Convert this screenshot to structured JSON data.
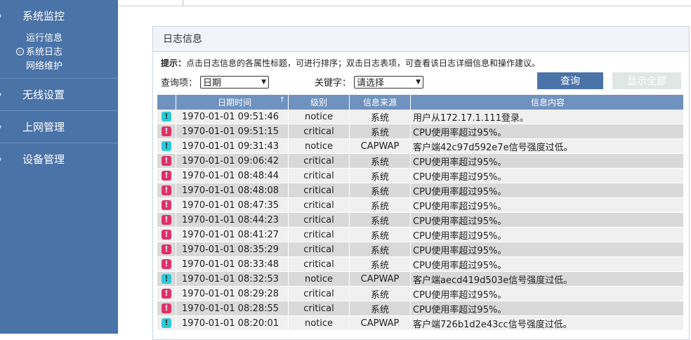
{
  "sidebar": {
    "groups": [
      {
        "label": "系统监控",
        "subitems": [
          "运行信息",
          "系统日志",
          "网络维护"
        ]
      },
      {
        "label": "无线设置"
      },
      {
        "label": "上网管理"
      },
      {
        "label": "设备管理"
      }
    ]
  },
  "panel": {
    "title": "日志信息",
    "tip_label": "提示：",
    "tip_text": "点击日志信息的各属性标题，可进行排序；双击日志表项，可查看该日志详细信息和操作建议。"
  },
  "query": {
    "field_label": "查询项：",
    "field_value": "日期",
    "keyword_label": "关键字：",
    "keyword_value": "请选择",
    "query_button": "查询",
    "show_all_button": "显示全部"
  },
  "table": {
    "headers": {
      "time": "日期时间",
      "level": "级别",
      "source": "信息来源",
      "message": "信息内容"
    },
    "rows": [
      {
        "time": "1970-01-01 09:51:46",
        "level": "notice",
        "source": "系统",
        "message": "用户从172.17.1.111登录。"
      },
      {
        "time": "1970-01-01 09:51:15",
        "level": "critical",
        "source": "系统",
        "message": "CPU使用率超过95%。"
      },
      {
        "time": "1970-01-01 09:31:43",
        "level": "notice",
        "source": "CAPWAP",
        "message": "客户端42c97d592e7e信号强度过低。"
      },
      {
        "time": "1970-01-01 09:06:42",
        "level": "critical",
        "source": "系统",
        "message": "CPU使用率超过95%。"
      },
      {
        "time": "1970-01-01 08:48:44",
        "level": "critical",
        "source": "系统",
        "message": "CPU使用率超过95%。"
      },
      {
        "time": "1970-01-01 08:48:08",
        "level": "critical",
        "source": "系统",
        "message": "CPU使用率超过95%。"
      },
      {
        "time": "1970-01-01 08:47:35",
        "level": "critical",
        "source": "系统",
        "message": "CPU使用率超过95%。"
      },
      {
        "time": "1970-01-01 08:44:23",
        "level": "critical",
        "source": "系统",
        "message": "CPU使用率超过95%。"
      },
      {
        "time": "1970-01-01 08:41:27",
        "level": "critical",
        "source": "系统",
        "message": "CPU使用率超过95%。"
      },
      {
        "time": "1970-01-01 08:35:29",
        "level": "critical",
        "source": "系统",
        "message": "CPU使用率超过95%。"
      },
      {
        "time": "1970-01-01 08:33:48",
        "level": "critical",
        "source": "系统",
        "message": "CPU使用率超过95%。"
      },
      {
        "time": "1970-01-01 08:32:53",
        "level": "notice",
        "source": "CAPWAP",
        "message": "客户端aecd419d503e信号强度过低。"
      },
      {
        "time": "1970-01-01 08:29:28",
        "level": "critical",
        "source": "系统",
        "message": "CPU使用率超过95%。"
      },
      {
        "time": "1970-01-01 08:28:55",
        "level": "critical",
        "source": "系统",
        "message": "CPU使用率超过95%。"
      },
      {
        "time": "1970-01-01 08:20:01",
        "level": "notice",
        "source": "CAPWAP",
        "message": "客户端726b1d2e43cc信号强度过低。"
      }
    ]
  },
  "colors": {
    "sidebar_bg": "#4a73a8",
    "header_bg": "#7092bf",
    "notice": "#2fc8d8",
    "critical": "#e0306a"
  }
}
